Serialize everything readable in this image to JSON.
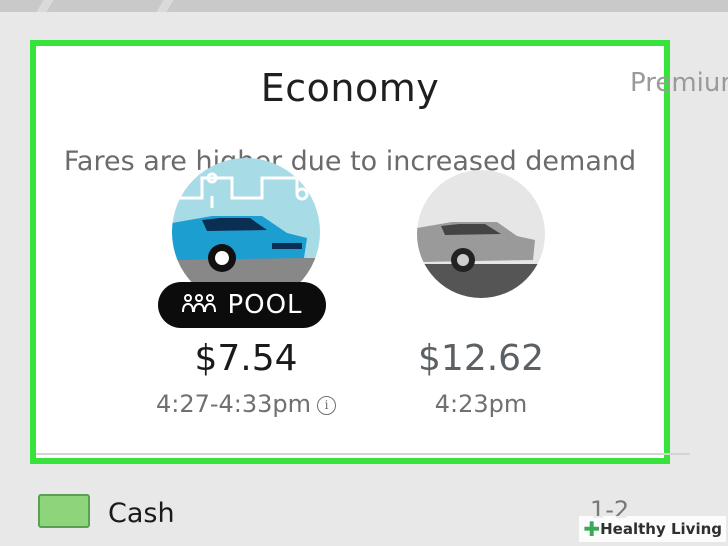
{
  "header": {
    "title": "Economy",
    "next_tab": "Premium"
  },
  "notice": "Fares are higher due to increased demand",
  "vehicles": [
    {
      "name": "POOL",
      "price": "$7.54",
      "eta": "4:27-4:33pm",
      "selected": true
    },
    {
      "name": "",
      "price": "$12.62",
      "eta": "4:23pm",
      "selected": false
    }
  ],
  "payment": {
    "method": "Cash",
    "seats": "1-2"
  },
  "watermark": "Healthy Living",
  "colors": {
    "highlight": "#35e33b",
    "pool_bg": "#a7dbe6",
    "car_blue": "#1c9ed1"
  }
}
